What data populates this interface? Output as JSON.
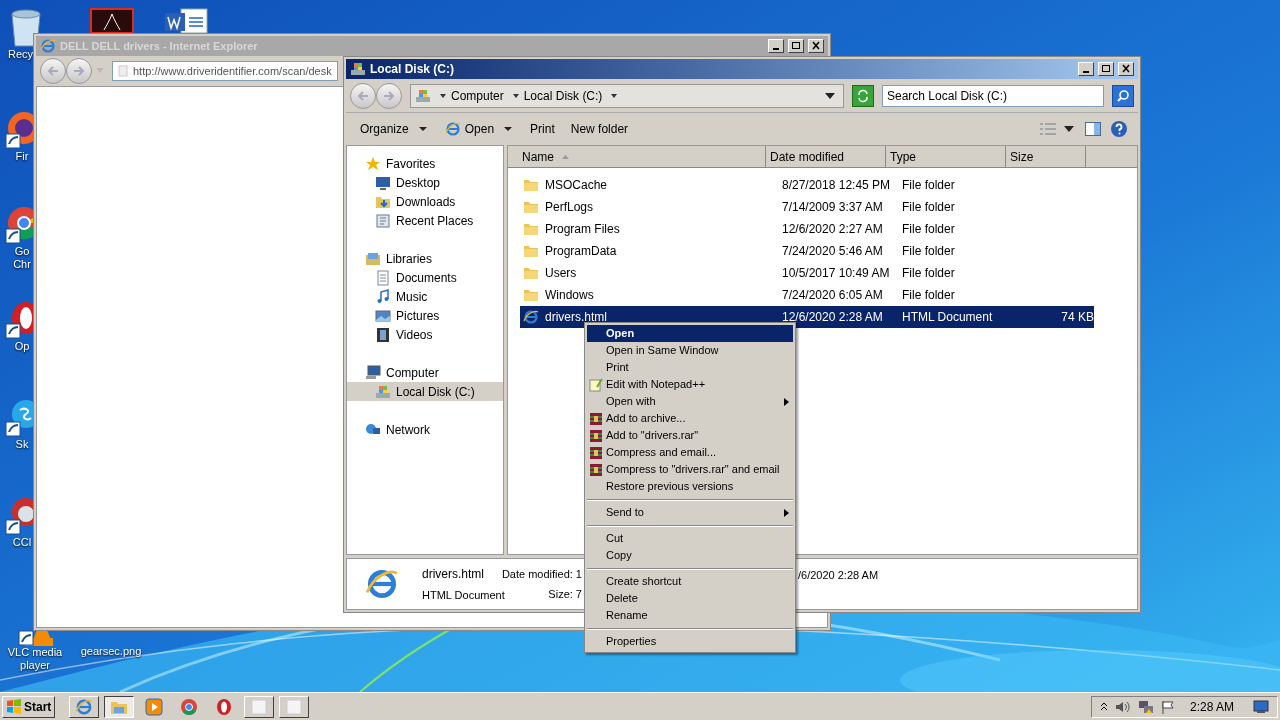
{
  "desktop": {
    "icons": [
      {
        "kind": "bin",
        "lines": [
          "Recy"
        ]
      },
      {
        "kind": "pdf"
      },
      {
        "kind": "word"
      },
      {
        "kind": "firefox",
        "lines": [
          "Fir"
        ]
      },
      {
        "kind": "chrome",
        "lines": [
          "Go",
          "Chr"
        ]
      },
      {
        "kind": "opera",
        "lines": [
          "Op"
        ]
      },
      {
        "kind": "skype",
        "lines": [
          "Sk"
        ]
      },
      {
        "kind": "ccleaner",
        "lines": [
          "CCl"
        ]
      },
      {
        "kind": "vlc",
        "lines": [
          "VLC media",
          "player"
        ]
      },
      {
        "lines": [
          "gearsec.png"
        ]
      }
    ]
  },
  "ie_window": {
    "title": "DELL DELL drivers - Internet Explorer",
    "url": "http://www.driveridentifier.com/scan/desk"
  },
  "explorer": {
    "title": "Local Disk (C:)",
    "breadcrumb": [
      "Computer",
      "Local Disk (C:)"
    ],
    "search": {
      "placeholder": "Search Local Disk (C:)"
    },
    "toolbar": [
      {
        "label": "Organize",
        "kind": "menu"
      },
      {
        "label": "Open",
        "kind": "open"
      },
      {
        "label": "Print",
        "kind": "plain"
      },
      {
        "label": "New folder",
        "kind": "plain"
      }
    ],
    "nav": [
      {
        "label": "Favorites",
        "kind": "favorites",
        "selected": false,
        "children": [
          {
            "label": "Desktop",
            "kind": "desktop",
            "selected": false
          },
          {
            "label": "Downloads",
            "kind": "downloads",
            "selected": false
          },
          {
            "label": "Recent Places",
            "kind": "recent",
            "selected": false
          }
        ]
      },
      {
        "label": "Libraries",
        "kind": "libraries",
        "selected": false,
        "children": [
          {
            "label": "Documents",
            "kind": "documents",
            "selected": false
          },
          {
            "label": "Music",
            "kind": "music",
            "selected": false
          },
          {
            "label": "Pictures",
            "kind": "pictures",
            "selected": false
          },
          {
            "label": "Videos",
            "kind": "videos",
            "selected": false
          }
        ]
      },
      {
        "label": "Computer",
        "kind": "computer",
        "selected": false,
        "children": [
          {
            "label": "Local Disk (C:)",
            "kind": "disk",
            "selected": true
          }
        ]
      },
      {
        "label": "Network",
        "kind": "network",
        "selected": false
      }
    ],
    "columns": [
      {
        "label": "Name",
        "sorted": true
      },
      {
        "label": "Date modified",
        "sorted": false
      },
      {
        "label": "Type",
        "sorted": false
      },
      {
        "label": "Size",
        "sorted": false
      }
    ],
    "rows": [
      {
        "kind": "folder",
        "name": "MSOCache",
        "date": "8/27/2018 12:45 PM",
        "type": "File folder",
        "selected": false
      },
      {
        "kind": "folder",
        "name": "PerfLogs",
        "date": "7/14/2009 3:37 AM",
        "type": "File folder",
        "selected": false
      },
      {
        "kind": "folder",
        "name": "Program Files",
        "date": "12/6/2020 2:27 AM",
        "type": "File folder",
        "selected": false
      },
      {
        "kind": "folder",
        "name": "ProgramData",
        "date": "7/24/2020 5:46 AM",
        "type": "File folder",
        "selected": false
      },
      {
        "kind": "folder",
        "name": "Users",
        "date": "10/5/2017 10:49 AM",
        "type": "File folder",
        "selected": false
      },
      {
        "kind": "folder",
        "name": "Windows",
        "date": "7/24/2020 6:05 AM",
        "type": "File folder",
        "selected": false
      },
      {
        "kind": "html",
        "name": "drivers.html",
        "date": "12/6/2020 2:28 AM",
        "type": "HTML Document",
        "size": "74 KB",
        "selected": true
      }
    ],
    "details": {
      "name": "drivers.html",
      "type": "HTML Document",
      "date_label": "Date modified: 1",
      "size_label": "Size: 7",
      "date_tail": "/6/2020 2:28 AM"
    }
  },
  "context_menu": [
    {
      "kind": "plain",
      "label": "Open",
      "bold": true,
      "selected": true,
      "submenu": false
    },
    {
      "kind": "plain",
      "label": "Open in Same Window",
      "bold": false,
      "selected": false,
      "submenu": false
    },
    {
      "kind": "plain",
      "label": "Print",
      "bold": false,
      "selected": false,
      "submenu": false
    },
    {
      "kind": "notepad",
      "label": "Edit with Notepad++",
      "bold": false,
      "selected": false,
      "submenu": false
    },
    {
      "kind": "plain",
      "label": "Open with",
      "bold": false,
      "selected": false,
      "submenu": true
    },
    {
      "kind": "archive",
      "label": "Add to archive...",
      "bold": false,
      "selected": false,
      "submenu": false
    },
    {
      "kind": "archive",
      "label": "Add to \"drivers.rar\"",
      "bold": false,
      "selected": false,
      "submenu": false
    },
    {
      "kind": "archive",
      "label": "Compress and email...",
      "bold": false,
      "selected": false,
      "submenu": false
    },
    {
      "kind": "archive",
      "label": "Compress to \"drivers.rar\" and email",
      "bold": false,
      "selected": false,
      "submenu": false
    },
    {
      "kind": "plain",
      "label": "Restore previous versions",
      "bold": false,
      "selected": false,
      "submenu": false
    },
    {
      "kind": "separator"
    },
    {
      "kind": "plain",
      "label": "Send to",
      "bold": false,
      "selected": false,
      "submenu": true
    },
    {
      "kind": "separator"
    },
    {
      "kind": "plain",
      "label": "Cut",
      "bold": false,
      "selected": false,
      "submenu": false
    },
    {
      "kind": "plain",
      "label": "Copy",
      "bold": false,
      "selected": false,
      "submenu": false
    },
    {
      "kind": "separator"
    },
    {
      "kind": "plain",
      "label": "Create shortcut",
      "bold": false,
      "selected": false,
      "submenu": false
    },
    {
      "kind": "plain",
      "label": "Delete",
      "bold": false,
      "selected": false,
      "submenu": false
    },
    {
      "kind": "plain",
      "label": "Rename",
      "bold": false,
      "selected": false,
      "submenu": false
    },
    {
      "kind": "separator"
    },
    {
      "kind": "plain",
      "label": "Properties",
      "bold": false,
      "selected": false,
      "submenu": false
    }
  ],
  "taskbar": {
    "start": "Start",
    "buttons": [
      {
        "kind": "ie",
        "selected": false
      },
      {
        "kind": "explorer",
        "selected": true
      },
      {
        "kind": "media",
        "selected": false
      },
      {
        "kind": "chrome",
        "selected": false
      },
      {
        "kind": "opera",
        "selected": false
      },
      {
        "kind": "blank",
        "selected": false
      },
      {
        "kind": "blank",
        "selected": false
      }
    ],
    "clock": "2:28 AM"
  }
}
